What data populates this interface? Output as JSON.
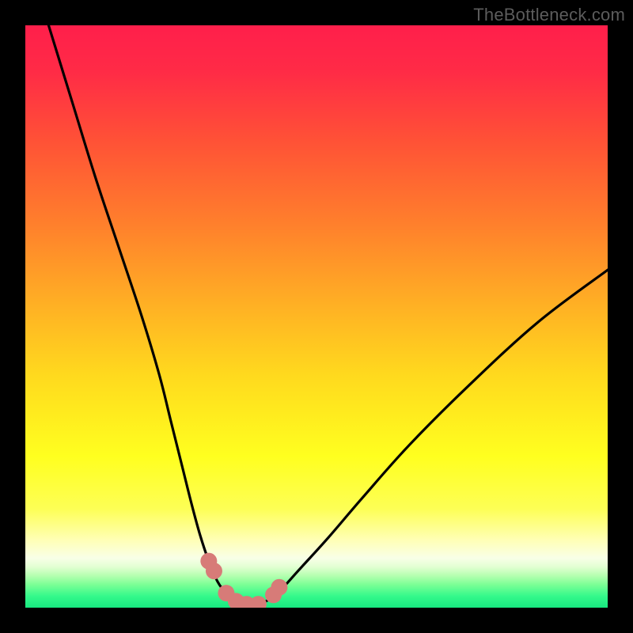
{
  "watermark": "TheBottleneck.com",
  "colors": {
    "frame": "#000000",
    "curve_stroke": "#000000",
    "marker_fill": "#d77b78",
    "gradient_stops": [
      {
        "offset": 0.0,
        "color": "#ff1f4b"
      },
      {
        "offset": 0.08,
        "color": "#ff2b46"
      },
      {
        "offset": 0.2,
        "color": "#ff5236"
      },
      {
        "offset": 0.34,
        "color": "#ff7f2c"
      },
      {
        "offset": 0.48,
        "color": "#ffb024"
      },
      {
        "offset": 0.6,
        "color": "#ffd91e"
      },
      {
        "offset": 0.74,
        "color": "#ffff1f"
      },
      {
        "offset": 0.83,
        "color": "#fdff55"
      },
      {
        "offset": 0.885,
        "color": "#ffffb8"
      },
      {
        "offset": 0.915,
        "color": "#f8ffe7"
      },
      {
        "offset": 0.93,
        "color": "#e2ffd2"
      },
      {
        "offset": 0.945,
        "color": "#b5ffb0"
      },
      {
        "offset": 0.96,
        "color": "#7dff96"
      },
      {
        "offset": 0.98,
        "color": "#35f98b"
      },
      {
        "offset": 1.0,
        "color": "#17e880"
      }
    ]
  },
  "chart_data": {
    "type": "line",
    "title": "",
    "xlabel": "",
    "ylabel": "",
    "xlim": [
      0,
      100
    ],
    "ylim": [
      0,
      100
    ],
    "series": [
      {
        "name": "bottleneck-curve",
        "x": [
          4,
          8,
          12,
          16,
          20,
          23,
          25,
          27,
          28.5,
          30,
          31.5,
          33,
          34.5,
          36,
          38,
          40,
          42,
          44,
          47,
          52,
          58,
          66,
          76,
          88,
          100
        ],
        "y": [
          100,
          87,
          74,
          62,
          50,
          40,
          32,
          24,
          18,
          12.5,
          8,
          4.5,
          2.5,
          1.3,
          0.6,
          0.6,
          1.5,
          3.2,
          6.5,
          12,
          19,
          28,
          38,
          49,
          58
        ]
      }
    ],
    "markers": {
      "name": "highlighted-points",
      "x": [
        31.5,
        32.4,
        34.5,
        36.2,
        38.0,
        40.0,
        42.6,
        43.6
      ],
      "y": [
        8.0,
        6.3,
        2.5,
        1.1,
        0.6,
        0.6,
        2.2,
        3.5
      ]
    }
  }
}
